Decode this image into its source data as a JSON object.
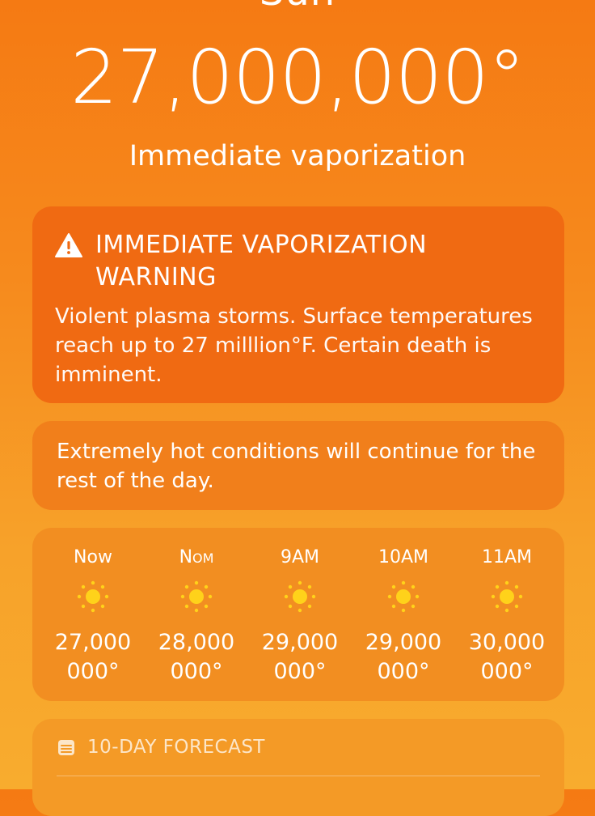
{
  "location": "Sun",
  "current": {
    "temperature": "27,000,000°",
    "condition": "Immediate vaporization"
  },
  "warning": {
    "icon": "warning-triangle-icon",
    "title": "IMMEDIATE VAPORIZATION WARNING",
    "body": "Violent plasma storms. Surface temperatures reach up to 27 milllion°F. Certain death is imminent."
  },
  "summary": {
    "text": "Extremely hot conditions will continue for the rest of the day."
  },
  "hourly": [
    {
      "label": "Now",
      "icon": "sun-icon",
      "temp_line1": "27,000",
      "temp_line2": "000°"
    },
    {
      "label": "NOM",
      "icon": "sun-icon",
      "temp_line1": "28,000",
      "temp_line2": "000°"
    },
    {
      "label": "9AM",
      "icon": "sun-icon",
      "temp_line1": "29,000",
      "temp_line2": "000°"
    },
    {
      "label": "10AM",
      "icon": "sun-icon",
      "temp_line1": "29,000",
      "temp_line2": "000°"
    },
    {
      "label": "11AM",
      "icon": "sun-icon",
      "temp_line1": "30,000",
      "temp_line2": "000°"
    }
  ],
  "forecast": {
    "icon": "calendar-icon",
    "title": "10-DAY FORECAST"
  },
  "colors": {
    "background_top": "#f57a13",
    "background_bottom": "#f8ac2e",
    "warning_card": "#f06a12",
    "sun_icon": "#ffd21a"
  }
}
